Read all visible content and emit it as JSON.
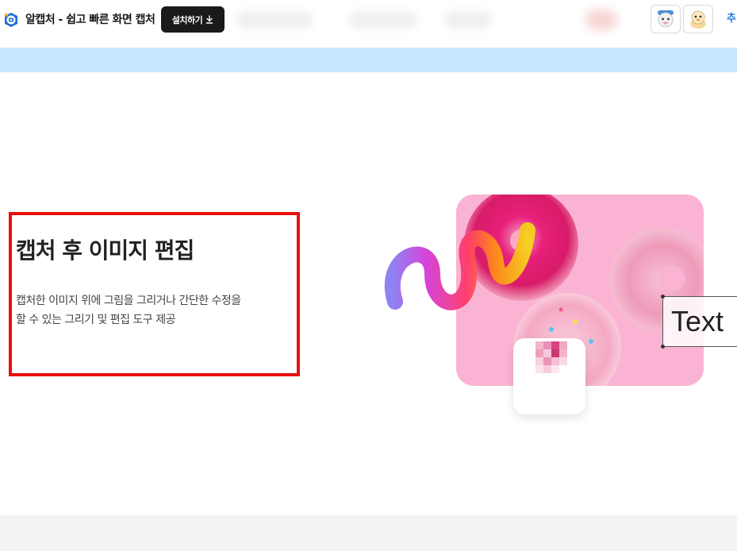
{
  "header": {
    "app_title": "알캡처 - 쉽고 빠른 화면 캡처",
    "install_button": "설치하기",
    "more_link": "추"
  },
  "feature": {
    "title": "캡처 후 이미지 편집",
    "desc_line1": "캡처한 이미지 위에 그림을 그리거나 간단한 수정을",
    "desc_line2": "할 수 있는 그리기 및 편집 도구 제공"
  },
  "illustration": {
    "text_label": "Text"
  },
  "colors": {
    "banner": "#c6e6ff",
    "highlight_border": "#e8100e",
    "install_button_bg": "#1a1a1a",
    "more_link": "#1b7be6"
  },
  "icons": {
    "logo": "alcapture-logo-icon",
    "download": "download-icon",
    "avatar1": "mascot-avatar-icon",
    "avatar2": "duck-avatar-icon"
  }
}
